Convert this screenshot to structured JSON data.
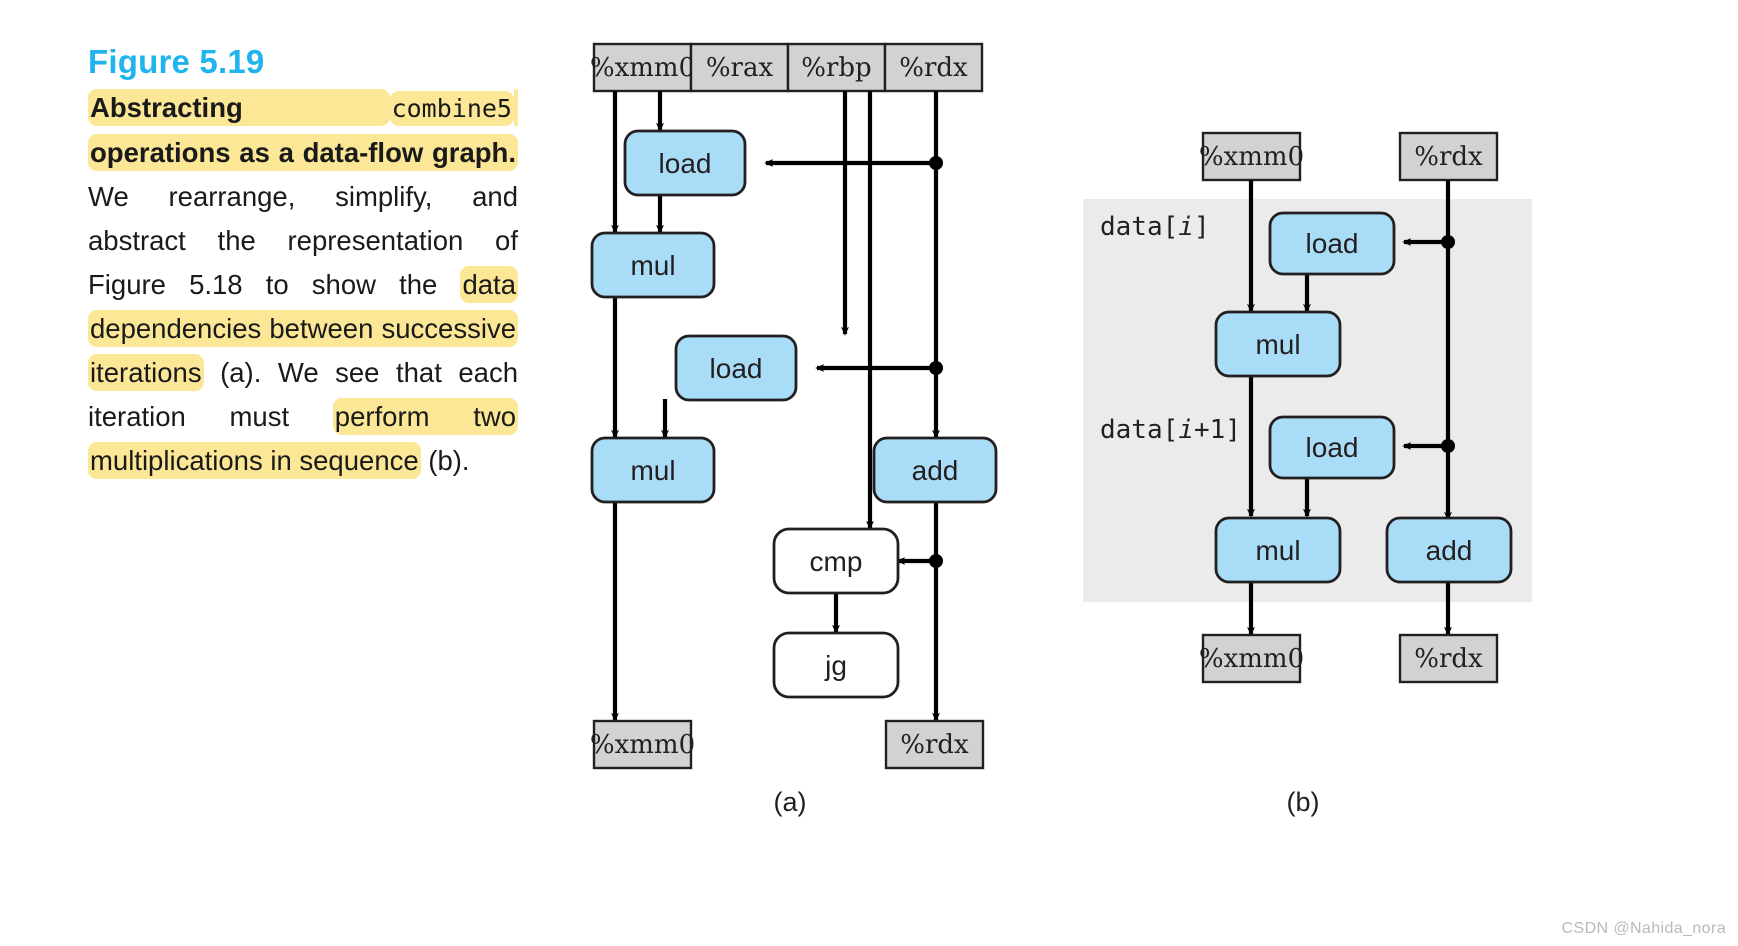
{
  "figure": {
    "number_label": "Figure 5.19",
    "caption_segments": [
      {
        "text": "Abstracting ",
        "bold": true,
        "highlight": true,
        "mono": false
      },
      {
        "text": "combine5",
        "bold": false,
        "highlight": true,
        "mono": true
      },
      {
        "text": " operations as a data-flow graph.",
        "bold": true,
        "highlight": true,
        "mono": false
      },
      {
        "text": " We rearrange, simplify, and abstract the representation of Figure 5.18 to show the ",
        "bold": false,
        "highlight": false,
        "mono": false
      },
      {
        "text": "data dependencies between successive iterations",
        "bold": false,
        "highlight": true,
        "mono": false
      },
      {
        "text": " (a). We see that each iteration must ",
        "bold": false,
        "highlight": false,
        "mono": false
      },
      {
        "text": "perform two multiplications in sequence",
        "bold": false,
        "highlight": true,
        "mono": false
      },
      {
        "text": " (b).",
        "bold": false,
        "highlight": false,
        "mono": false
      }
    ],
    "sublabel_a": "(a)",
    "sublabel_b": "(b)",
    "watermark": "CSDN @Nahida_nora"
  },
  "colors": {
    "node_fill": "#a9ddf7",
    "node_stroke": "#231f20",
    "register_fill": "#d2d2d2",
    "register_stroke": "#231f20",
    "white_node_fill": "#ffffff",
    "panel_fill": "#ebebeb",
    "heading_blue": "#1fb4ee",
    "highlight_yellow": "#fbe795",
    "edge": "#000000"
  },
  "panel_a": {
    "registers_top": [
      "%xmm0",
      "%rax",
      "%rbp",
      "%rdx"
    ],
    "registers_bottom": [
      "%xmm0",
      "%rdx"
    ],
    "nodes": [
      {
        "id": "a-load1",
        "label": "load",
        "kind": "blue"
      },
      {
        "id": "a-mul1",
        "label": "mul",
        "kind": "blue"
      },
      {
        "id": "a-load2",
        "label": "load",
        "kind": "blue"
      },
      {
        "id": "a-mul2",
        "label": "mul",
        "kind": "blue"
      },
      {
        "id": "a-add",
        "label": "add",
        "kind": "blue"
      },
      {
        "id": "a-cmp",
        "label": "cmp",
        "kind": "white"
      },
      {
        "id": "a-jg",
        "label": "jg",
        "kind": "white"
      }
    ]
  },
  "panel_b": {
    "registers_top": [
      "%xmm0",
      "%rdx"
    ],
    "registers_bottom": [
      "%xmm0",
      "%rdx"
    ],
    "group_labels": [
      "data[i]",
      "data[i+1]"
    ],
    "group_label_parts": [
      {
        "prefix": "data[",
        "italic": "i",
        "suffix": "]"
      },
      {
        "prefix": "data[",
        "italic": "i",
        "suffix": "+1]"
      }
    ],
    "nodes": [
      {
        "id": "b-load1",
        "label": "load",
        "kind": "blue"
      },
      {
        "id": "b-mul1",
        "label": "mul",
        "kind": "blue"
      },
      {
        "id": "b-load2",
        "label": "load",
        "kind": "blue"
      },
      {
        "id": "b-mul2",
        "label": "mul",
        "kind": "blue"
      },
      {
        "id": "b-add",
        "label": "add",
        "kind": "blue"
      }
    ]
  }
}
